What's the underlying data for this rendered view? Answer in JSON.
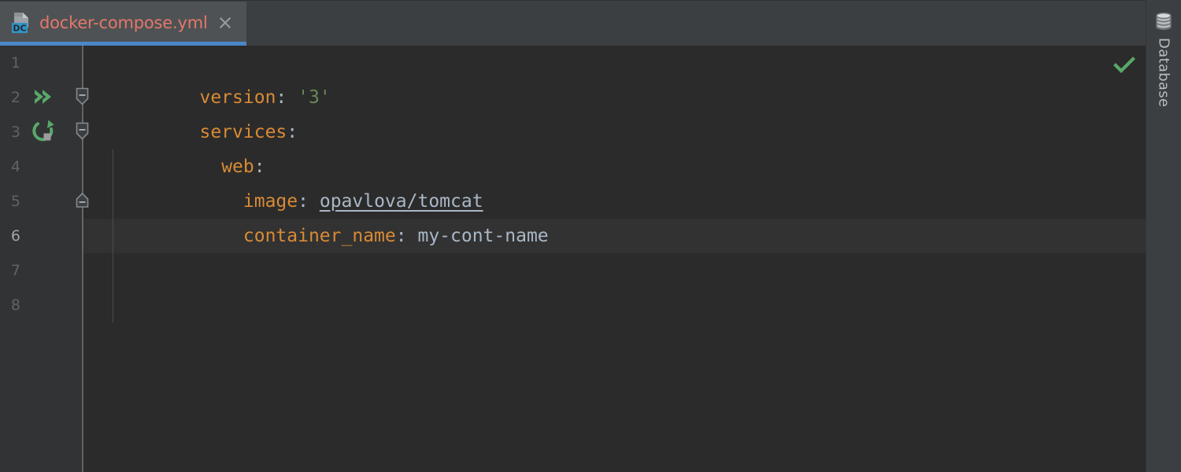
{
  "window": {
    "theme_colors": {
      "editor_background": "#2b2b2b",
      "gutter_background": "#313335",
      "tabbar_background": "#3c3f41",
      "active_tab_background": "#4e5254",
      "active_tab_underline": "#4a88c7",
      "caret_line_background": "#323232",
      "keyword_orange": "#d98a35",
      "string_green": "#6a8759",
      "text_gray": "#a9b7c6",
      "tab_title_color": "#e4776a",
      "run_icon_green": "#59a869",
      "line_number_color": "#606366",
      "current_line_number_color": "#a4a3a3"
    }
  },
  "tabbar": {
    "tabs": [
      {
        "title": "docker-compose.yml",
        "icon": "docker-compose-file-icon",
        "icon_badge": "DC",
        "close_icon": "close-icon",
        "active": true
      }
    ]
  },
  "editor": {
    "language": "yaml",
    "inspection_status_icon": "checkmark-icon",
    "lines": [
      {
        "number": "1",
        "current": false,
        "gutter_icon": null,
        "fold_marker": null,
        "tokens": [
          {
            "text": "version",
            "kind": "key"
          },
          {
            "text": ":",
            "kind": "punct"
          },
          {
            "text": " ",
            "kind": "plain"
          },
          {
            "text": "'3'",
            "kind": "string"
          }
        ]
      },
      {
        "number": "2",
        "current": false,
        "gutter_icon": "run-all-services-icon",
        "fold_marker": "collapse-icon",
        "tokens": [
          {
            "text": "services",
            "kind": "key"
          },
          {
            "text": ":",
            "kind": "punct"
          }
        ]
      },
      {
        "number": "3",
        "current": false,
        "gutter_icon": "run-service-icon",
        "fold_marker": "collapse-icon",
        "tokens": [
          {
            "text": "  ",
            "kind": "plain"
          },
          {
            "text": "web",
            "kind": "key"
          },
          {
            "text": ":",
            "kind": "punct"
          }
        ]
      },
      {
        "number": "4",
        "current": false,
        "gutter_icon": null,
        "fold_marker": null,
        "tokens": [
          {
            "text": "    ",
            "kind": "plain"
          },
          {
            "text": "image",
            "kind": "key"
          },
          {
            "text": ":",
            "kind": "punct"
          },
          {
            "text": " ",
            "kind": "plain"
          },
          {
            "text": "opavlova/tomcat",
            "kind": "reference"
          }
        ]
      },
      {
        "number": "5",
        "current": false,
        "gutter_icon": null,
        "fold_marker": "fold-end-icon",
        "tokens": [
          {
            "text": "    ",
            "kind": "plain"
          },
          {
            "text": "container_name",
            "kind": "key"
          },
          {
            "text": ":",
            "kind": "punct"
          },
          {
            "text": " ",
            "kind": "plain"
          },
          {
            "text": "my-cont-name",
            "kind": "value"
          }
        ]
      },
      {
        "number": "6",
        "current": true,
        "gutter_icon": null,
        "fold_marker": null,
        "tokens": []
      },
      {
        "number": "7",
        "current": false,
        "gutter_icon": null,
        "fold_marker": null,
        "tokens": []
      },
      {
        "number": "8",
        "current": false,
        "gutter_icon": null,
        "fold_marker": null,
        "tokens": []
      }
    ]
  },
  "toolwindow_strip": {
    "buttons": [
      {
        "label": "Database",
        "icon": "database-icon"
      }
    ]
  }
}
